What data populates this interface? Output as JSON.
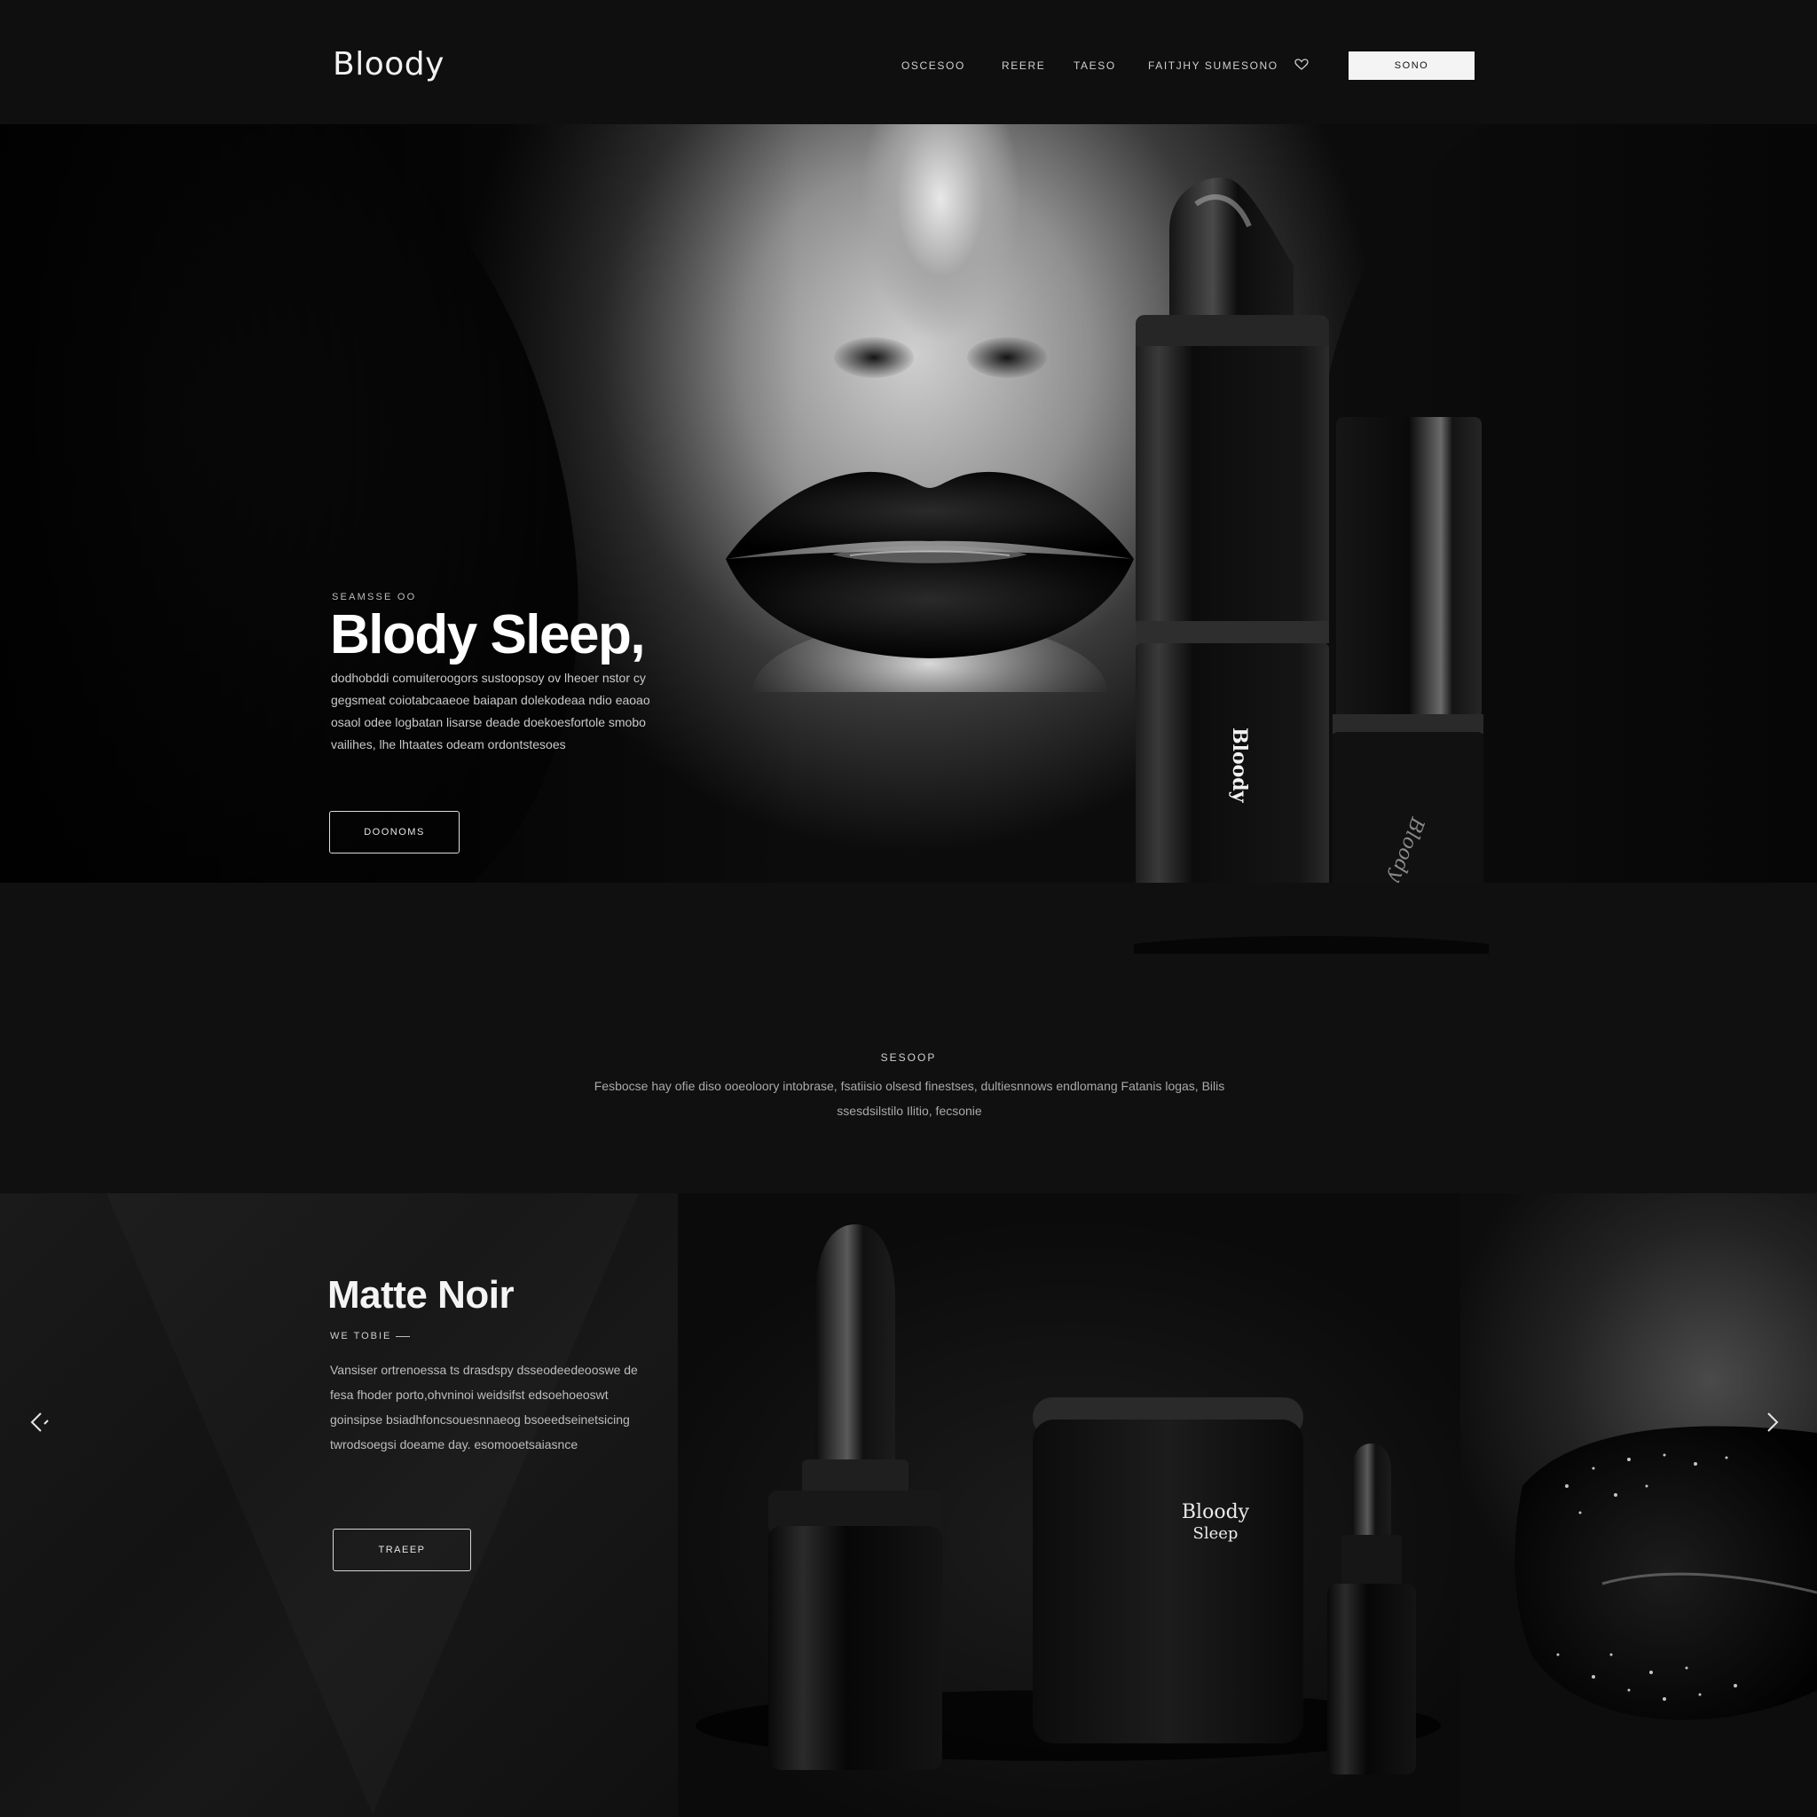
{
  "nav": {
    "logo": "Bloody",
    "links": [
      "OSCESOO",
      "REERE",
      "TAESO",
      "FAITJHY SUMESONO"
    ],
    "cta_label": "SONO"
  },
  "hero": {
    "eyebrow": "SEAMSSE OO",
    "title": "Blody Sleep,",
    "description": "dodhobddi comuiteroogors sustoopsoy ov lheoer nstor cy gegsmeat coiotabcaaeoe baiapan dolekodeaa ndio eaoao osaol odee logbatan lisarse deade doekoesfortole smobo vailihes, lhe lhtaates odeam ordontstesoes",
    "button_label": "DOONOMS",
    "stick_big_label": "Bloody",
    "stick_small_label": "Bloody"
  },
  "info": {
    "eyebrow": "SESOOP",
    "text": "Fesbocse hay ofie diso ooeoloory intobrase, fsatiisio olsesd finestses, dultiesnnows endlomang Fatanis logas, Bilis ssesdsilstilo Ilitio, fecsonie"
  },
  "product": {
    "title": "Matte Noir",
    "subtitle": "WE TOBIE",
    "description": "Vansiser ortrenoessa ts drasdspy dsseodeedeooswe de fesa fhoder porto,ohvninoi weidsifst edsoehoeoswt goinsipse bsiadhfoncsouesnnaeog bsoeedseinetsicing twrodsoegsi doeame day. esomooetsaiasnce",
    "button_label": "TRAEEP",
    "jar_label_line1": "Bloody",
    "jar_label_line2": "Sleep"
  },
  "icons": {
    "prev": "chevron-left-icon",
    "next": "chevron-right-icon",
    "heart": "heart-icon"
  },
  "colors": {
    "background": "#0e0e0e",
    "accent": "#f4f4f4",
    "text_muted": "#a9a9a9"
  }
}
